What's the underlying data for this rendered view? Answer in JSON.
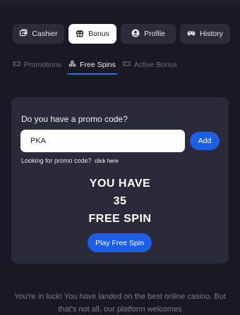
{
  "main_tabs": [
    {
      "label": "Cashier",
      "icon": "wallet-icon"
    },
    {
      "label": "Bonus",
      "icon": "gift-icon"
    },
    {
      "label": "Profile",
      "icon": "user-icon"
    },
    {
      "label": "History",
      "icon": "gamepad-icon"
    }
  ],
  "active_main_tab": "Bonus",
  "sub_tabs": [
    {
      "label": "Promotions",
      "icon": "ticket-icon"
    },
    {
      "label": "Free Spins",
      "icon": "spin-icon"
    },
    {
      "label": "Active Bonus",
      "icon": "ticket-icon"
    }
  ],
  "active_sub_tab": "Free Spins",
  "promo": {
    "question": "Do you have a promo code?",
    "input_value": "PKA",
    "add_label": "Add",
    "lookup_text": "Looking for promo code?",
    "lookup_link": "click here"
  },
  "free_spins": {
    "line1": "YOU HAVE",
    "count": "35",
    "line3": "FREE SPIN",
    "play_label": "Play Free Spin"
  },
  "footer": {
    "text": "You're in luck! You have landed on the best online casino. But that's not all, our platform welcomes"
  },
  "colors": {
    "background": "#1a1824",
    "card": "#2b2a3a",
    "accent": "#1c5ee6",
    "active_tab": "#ffffff"
  }
}
